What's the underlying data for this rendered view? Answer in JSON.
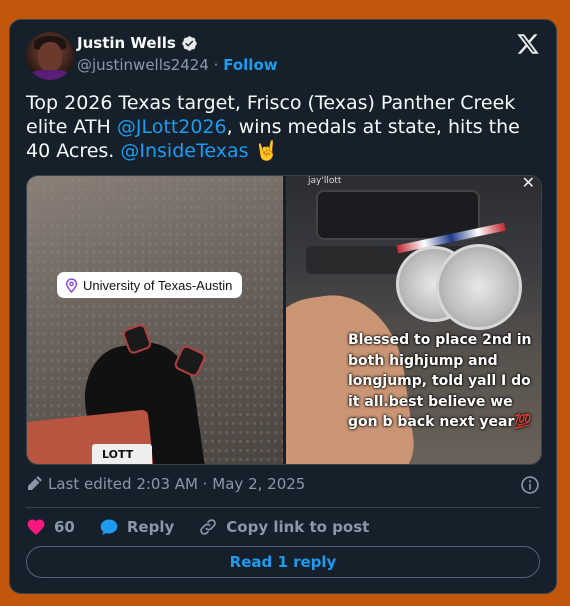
{
  "author": {
    "name": "Justin Wells",
    "handle": "@justinwells2424",
    "separator": "·",
    "follow_label": "Follow"
  },
  "tweet": {
    "text_parts": [
      "Top 2026 Texas target, Frisco (Texas) Panther Creek elite ATH ",
      "@JLott2026",
      ", wins medals at state, hits the 40 Acres. ",
      "@InsideTexas",
      " 🤘"
    ]
  },
  "media": {
    "location_tag": "University of Texas-Austin",
    "left_photo_tag_text": "LOTT",
    "story_user": "jay'llott",
    "story_caption": "Blessed to place 2nd in both highjump and longjump, told yall I do it all.best believe we gon b back next year💯"
  },
  "meta": {
    "edited_label": "Last edited 2:03 AM · May 2, 2025"
  },
  "actions": {
    "like_count": "60",
    "reply_label": "Reply",
    "copy_link_label": "Copy link to post"
  },
  "read_replies_label": "Read 1 reply",
  "colors": {
    "background": "#c2570c",
    "card": "#15202b",
    "accent": "#1d9bf0",
    "like": "#f91880",
    "muted": "#8b98a5"
  },
  "icons": [
    "verified-icon",
    "x-logo-icon",
    "location-pin-icon",
    "pencil-icon",
    "info-icon",
    "heart-icon",
    "reply-bubble-icon",
    "link-icon"
  ]
}
